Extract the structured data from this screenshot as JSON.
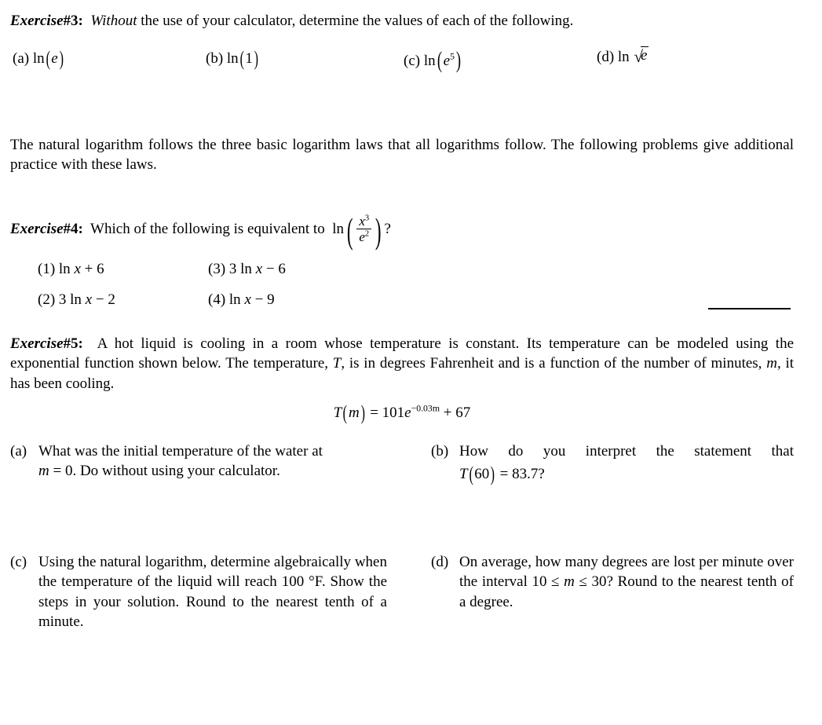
{
  "document": {
    "type": "math-worksheet",
    "background": "#ffffff",
    "text_color": "#000000"
  },
  "exercise3": {
    "label": "Exercise",
    "number": "#3:",
    "emphasis_word": "Without",
    "prompt_rest": " the use of your calculator, determine the values of each of the following.",
    "parts": [
      {
        "tag": "(a)",
        "expr_text": "ln(e)"
      },
      {
        "tag": "(b)",
        "expr_text": "ln(1)"
      },
      {
        "tag": "(c)",
        "expr_text": "ln(e^5)"
      },
      {
        "tag": "(d)",
        "expr_text": "ln √e"
      }
    ]
  },
  "paragraph": {
    "text": "The natural logarithm follows the three basic logarithm laws that all logarithms follow.  The following problems give additional practice with these laws."
  },
  "exercise4": {
    "label": "Exercise",
    "number": "#4:",
    "prompt": "Which of the following is equivalent to",
    "expr_text": "ln(x^3 / e^2)",
    "expr_numerator": "x",
    "expr_numerator_exp": "3",
    "expr_denominator": "e",
    "expr_denominator_exp": "2",
    "question_mark": "?",
    "choices": [
      {
        "tag": "(1)",
        "text": "ln x + 6"
      },
      {
        "tag": "(2)",
        "text": "3 ln x − 2"
      },
      {
        "tag": "(3)",
        "text": "3 ln x − 6"
      },
      {
        "tag": "(4)",
        "text": "ln x − 9"
      }
    ],
    "answer_blank": ""
  },
  "exercise5": {
    "label": "Exercise",
    "number": "#5:",
    "intro": "A hot liquid is cooling in a room whose temperature is constant. Its temperature can be modeled using the exponential function shown below. The temperature, T, is in degrees Fahrenheit and is a function of the number of minutes, m, it has been cooling.",
    "intro_segment_1": "A hot liquid is cooling in a room whose temperature is constant. Its temperature can be modeled using the exponential function shown below. The temperature, ",
    "intro_var_T": "T",
    "intro_segment_2": ", is in degrees Fahrenheit and is a function of the number of minutes, ",
    "intro_var_m": "m",
    "intro_segment_3": ", it has been cooling.",
    "formula_text": "T(m) = 101e^(-0.03m) + 67",
    "formula": {
      "function_name": "T",
      "variable": "m",
      "equals": "=",
      "coefficient": "101",
      "base": "e",
      "exponent": "−0.03m",
      "plus_constant": "+ 67"
    },
    "parts": [
      {
        "tag": "(a)",
        "line1": "What was the initial temperature of the water at",
        "line2_math": "m = 0",
        "line2_rest": ". Do without using your calculator."
      },
      {
        "tag": "(b)",
        "line1": "How do you interpret the statement that",
        "line2_math": "T(60) = 83.7",
        "line2_rest": "?"
      },
      {
        "tag": "(c)",
        "text_part1": "Using the natural logarithm, determine algebraically when the temperature of the liquid will reach ",
        "temp_value": "100 °F",
        "text_part2": ". Show the steps in your solution. Round to the nearest tenth of a minute."
      },
      {
        "tag": "(d)",
        "text_part1": "On average, how many degrees are lost per minute over the interval ",
        "interval": "10 ≤ m ≤ 30",
        "text_part2": "? Round to the nearest tenth of a degree."
      }
    ]
  }
}
